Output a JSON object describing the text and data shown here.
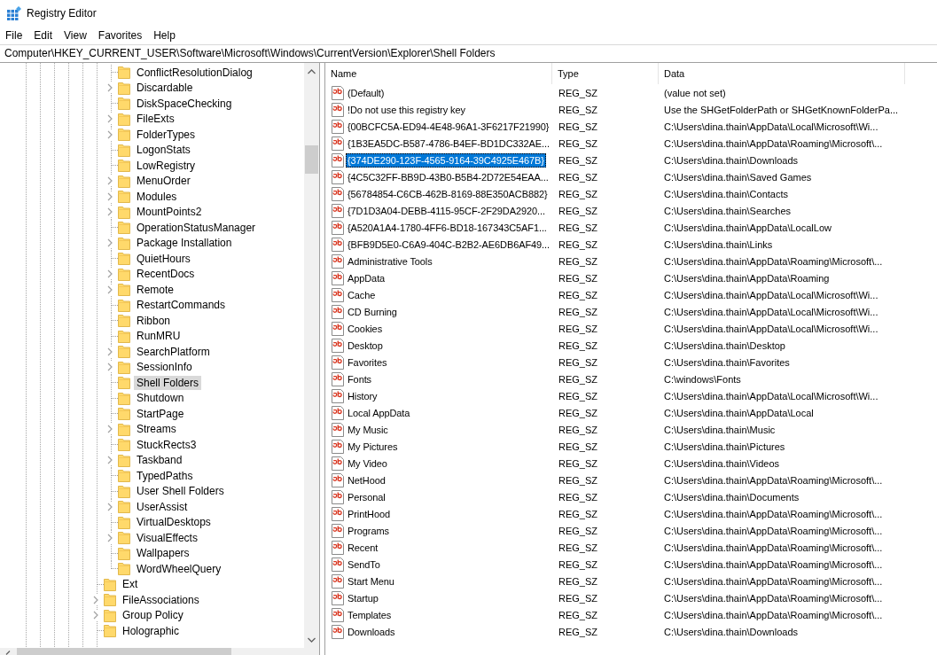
{
  "window": {
    "title": "Registry Editor"
  },
  "menu": [
    "File",
    "Edit",
    "View",
    "Favorites",
    "Help"
  ],
  "address_bar": {
    "value": "Computer\\HKEY_CURRENT_USER\\Software\\Microsoft\\Windows\\CurrentVersion\\Explorer\\Shell Folders"
  },
  "tree": {
    "nodes": [
      {
        "children": [
          {
            "label": "ConflictResolutionDialog",
            "has_subkeys": false,
            "selected": false
          },
          {
            "label": "Discardable",
            "has_subkeys": true,
            "selected": false
          },
          {
            "label": "DiskSpaceChecking",
            "has_subkeys": false,
            "selected": false
          },
          {
            "label": "FileExts",
            "has_subkeys": true,
            "selected": false
          },
          {
            "label": "FolderTypes",
            "has_subkeys": true,
            "selected": false
          },
          {
            "label": "LogonStats",
            "has_subkeys": false,
            "selected": false
          },
          {
            "label": "LowRegistry",
            "has_subkeys": false,
            "selected": false
          },
          {
            "label": "MenuOrder",
            "has_subkeys": true,
            "selected": false
          },
          {
            "label": "Modules",
            "has_subkeys": true,
            "selected": false
          },
          {
            "label": "MountPoints2",
            "has_subkeys": true,
            "selected": false
          },
          {
            "label": "OperationStatusManager",
            "has_subkeys": false,
            "selected": false
          },
          {
            "label": "Package Installation",
            "has_subkeys": true,
            "selected": false
          },
          {
            "label": "QuietHours",
            "has_subkeys": false,
            "selected": false
          },
          {
            "label": "RecentDocs",
            "has_subkeys": true,
            "selected": false
          },
          {
            "label": "Remote",
            "has_subkeys": true,
            "selected": false
          },
          {
            "label": "RestartCommands",
            "has_subkeys": false,
            "selected": false
          },
          {
            "label": "Ribbon",
            "has_subkeys": false,
            "selected": false
          },
          {
            "label": "RunMRU",
            "has_subkeys": false,
            "selected": false
          },
          {
            "label": "SearchPlatform",
            "has_subkeys": true,
            "selected": false
          },
          {
            "label": "SessionInfo",
            "has_subkeys": true,
            "selected": false
          },
          {
            "label": "Shell Folders",
            "has_subkeys": false,
            "selected": true
          },
          {
            "label": "Shutdown",
            "has_subkeys": false,
            "selected": false
          },
          {
            "label": "StartPage",
            "has_subkeys": false,
            "selected": false
          },
          {
            "label": "Streams",
            "has_subkeys": true,
            "selected": false
          },
          {
            "label": "StuckRects3",
            "has_subkeys": false,
            "selected": false
          },
          {
            "label": "Taskband",
            "has_subkeys": true,
            "selected": false
          },
          {
            "label": "TypedPaths",
            "has_subkeys": false,
            "selected": false
          },
          {
            "label": "User Shell Folders",
            "has_subkeys": false,
            "selected": false
          },
          {
            "label": "UserAssist",
            "has_subkeys": true,
            "selected": false
          },
          {
            "label": "VirtualDesktops",
            "has_subkeys": false,
            "selected": false
          },
          {
            "label": "VisualEffects",
            "has_subkeys": true,
            "selected": false
          },
          {
            "label": "Wallpapers",
            "has_subkeys": false,
            "selected": false
          },
          {
            "label": "WordWheelQuery",
            "has_subkeys": false,
            "selected": false
          }
        ]
      },
      {
        "label": "Ext",
        "has_subkeys": false,
        "selected": false
      },
      {
        "label": "FileAssociations",
        "has_subkeys": true,
        "selected": false
      },
      {
        "label": "Group Policy",
        "has_subkeys": true,
        "selected": false
      },
      {
        "label": "Holographic",
        "has_subkeys": false,
        "selected": false
      }
    ]
  },
  "values": {
    "columns": [
      "Name",
      "Type",
      "Data"
    ],
    "rows": [
      {
        "name": "(Default)",
        "type": "REG_SZ",
        "data": "(value not set)",
        "selected": false
      },
      {
        "name": "!Do not use this registry key",
        "type": "REG_SZ",
        "data": "Use the SHGetFolderPath or SHGetKnownFolderPa...",
        "selected": false
      },
      {
        "name": "{00BCFC5A-ED94-4E48-96A1-3F6217F21990}",
        "type": "REG_SZ",
        "data": "C:\\Users\\dina.thain\\AppData\\Local\\Microsoft\\Wi...",
        "selected": false
      },
      {
        "name": "{1B3EA5DC-B587-4786-B4EF-BD1DC332AE...",
        "type": "REG_SZ",
        "data": "C:\\Users\\dina.thain\\AppData\\Roaming\\Microsoft\\...",
        "selected": false
      },
      {
        "name": "{374DE290-123F-4565-9164-39C4925E467B}",
        "type": "REG_SZ",
        "data": "C:\\Users\\dina.thain\\Downloads",
        "selected": true
      },
      {
        "name": "{4C5C32FF-BB9D-43B0-B5B4-2D72E54EAA...",
        "type": "REG_SZ",
        "data": "C:\\Users\\dina.thain\\Saved Games",
        "selected": false
      },
      {
        "name": "{56784854-C6CB-462B-8169-88E350ACB882}",
        "type": "REG_SZ",
        "data": "C:\\Users\\dina.thain\\Contacts",
        "selected": false
      },
      {
        "name": "{7D1D3A04-DEBB-4115-95CF-2F29DA2920...",
        "type": "REG_SZ",
        "data": "C:\\Users\\dina.thain\\Searches",
        "selected": false
      },
      {
        "name": "{A520A1A4-1780-4FF6-BD18-167343C5AF1...",
        "type": "REG_SZ",
        "data": "C:\\Users\\dina.thain\\AppData\\LocalLow",
        "selected": false
      },
      {
        "name": "{BFB9D5E0-C6A9-404C-B2B2-AE6DB6AF49...",
        "type": "REG_SZ",
        "data": "C:\\Users\\dina.thain\\Links",
        "selected": false
      },
      {
        "name": "Administrative Tools",
        "type": "REG_SZ",
        "data": "C:\\Users\\dina.thain\\AppData\\Roaming\\Microsoft\\...",
        "selected": false
      },
      {
        "name": "AppData",
        "type": "REG_SZ",
        "data": "C:\\Users\\dina.thain\\AppData\\Roaming",
        "selected": false
      },
      {
        "name": "Cache",
        "type": "REG_SZ",
        "data": "C:\\Users\\dina.thain\\AppData\\Local\\Microsoft\\Wi...",
        "selected": false
      },
      {
        "name": "CD Burning",
        "type": "REG_SZ",
        "data": "C:\\Users\\dina.thain\\AppData\\Local\\Microsoft\\Wi...",
        "selected": false
      },
      {
        "name": "Cookies",
        "type": "REG_SZ",
        "data": "C:\\Users\\dina.thain\\AppData\\Local\\Microsoft\\Wi...",
        "selected": false
      },
      {
        "name": "Desktop",
        "type": "REG_SZ",
        "data": "C:\\Users\\dina.thain\\Desktop",
        "selected": false
      },
      {
        "name": "Favorites",
        "type": "REG_SZ",
        "data": "C:\\Users\\dina.thain\\Favorites",
        "selected": false
      },
      {
        "name": "Fonts",
        "type": "REG_SZ",
        "data": "C:\\windows\\Fonts",
        "selected": false
      },
      {
        "name": "History",
        "type": "REG_SZ",
        "data": "C:\\Users\\dina.thain\\AppData\\Local\\Microsoft\\Wi...",
        "selected": false
      },
      {
        "name": "Local AppData",
        "type": "REG_SZ",
        "data": "C:\\Users\\dina.thain\\AppData\\Local",
        "selected": false
      },
      {
        "name": "My Music",
        "type": "REG_SZ",
        "data": "C:\\Users\\dina.thain\\Music",
        "selected": false
      },
      {
        "name": "My Pictures",
        "type": "REG_SZ",
        "data": "C:\\Users\\dina.thain\\Pictures",
        "selected": false
      },
      {
        "name": "My Video",
        "type": "REG_SZ",
        "data": "C:\\Users\\dina.thain\\Videos",
        "selected": false
      },
      {
        "name": "NetHood",
        "type": "REG_SZ",
        "data": "C:\\Users\\dina.thain\\AppData\\Roaming\\Microsoft\\...",
        "selected": false
      },
      {
        "name": "Personal",
        "type": "REG_SZ",
        "data": "C:\\Users\\dina.thain\\Documents",
        "selected": false
      },
      {
        "name": "PrintHood",
        "type": "REG_SZ",
        "data": "C:\\Users\\dina.thain\\AppData\\Roaming\\Microsoft\\...",
        "selected": false
      },
      {
        "name": "Programs",
        "type": "REG_SZ",
        "data": "C:\\Users\\dina.thain\\AppData\\Roaming\\Microsoft\\...",
        "selected": false
      },
      {
        "name": "Recent",
        "type": "REG_SZ",
        "data": "C:\\Users\\dina.thain\\AppData\\Roaming\\Microsoft\\...",
        "selected": false
      },
      {
        "name": "SendTo",
        "type": "REG_SZ",
        "data": "C:\\Users\\dina.thain\\AppData\\Roaming\\Microsoft\\...",
        "selected": false
      },
      {
        "name": "Start Menu",
        "type": "REG_SZ",
        "data": "C:\\Users\\dina.thain\\AppData\\Roaming\\Microsoft\\...",
        "selected": false
      },
      {
        "name": "Startup",
        "type": "REG_SZ",
        "data": "C:\\Users\\dina.thain\\AppData\\Roaming\\Microsoft\\...",
        "selected": false
      },
      {
        "name": "Templates",
        "type": "REG_SZ",
        "data": "C:\\Users\\dina.thain\\AppData\\Roaming\\Microsoft\\...",
        "selected": false
      },
      {
        "name": "Downloads",
        "type": "REG_SZ",
        "data": "C:\\Users\\dina.thain\\Downloads",
        "selected": false
      }
    ]
  }
}
